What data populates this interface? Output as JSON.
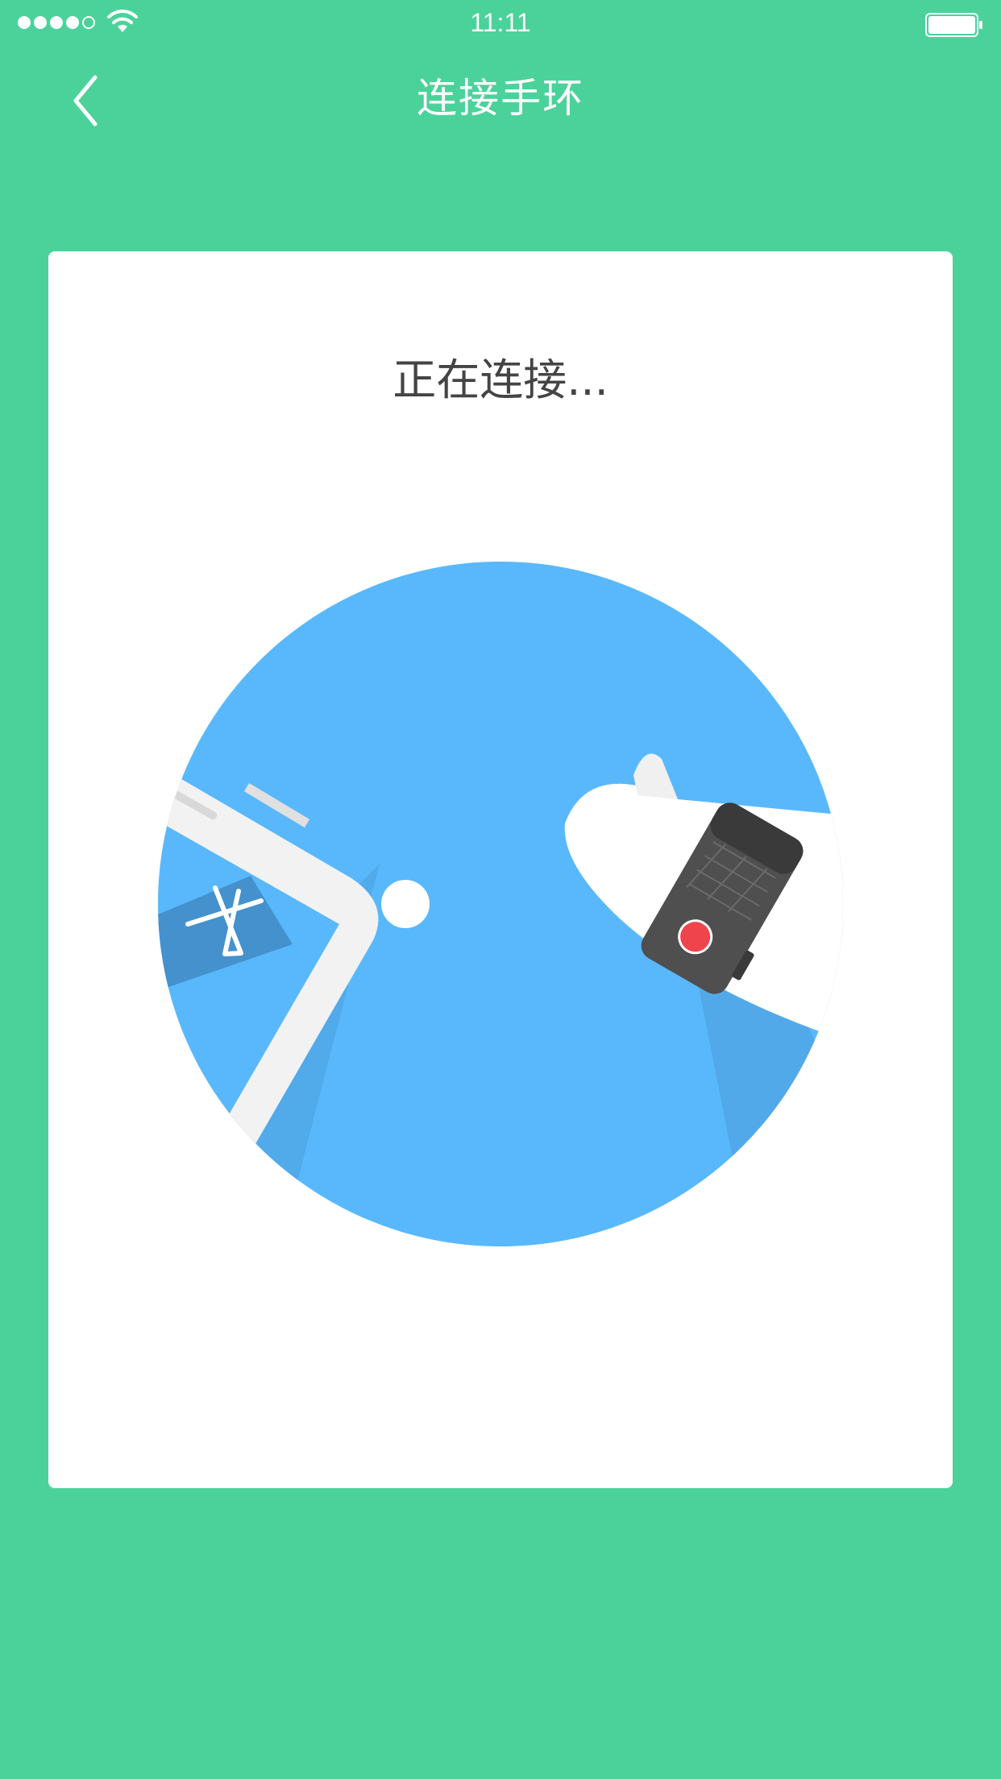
{
  "status_bar": {
    "time": "11:11",
    "signal_bars": 5,
    "signal_filled": 4,
    "battery_level": 1.0
  },
  "nav": {
    "title": "连接手环",
    "back_icon": "chevron-left-icon"
  },
  "card": {
    "status_text": "正在连接..."
  },
  "illustration": {
    "icons": [
      "phone-icon",
      "bluetooth-icon",
      "connection-dot",
      "wristband-icon"
    ]
  },
  "colors": {
    "background": "#4bd29a",
    "card": "#ffffff",
    "circle": "#59b8fc",
    "text": "#444444",
    "wristband_button": "#f0444c"
  }
}
